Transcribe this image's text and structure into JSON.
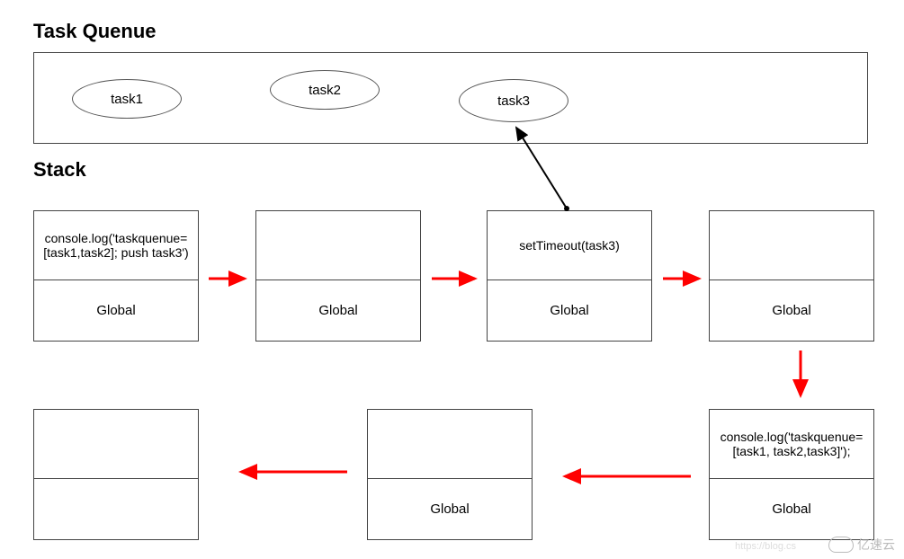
{
  "headings": {
    "queue": "Task Quenue",
    "stack": "Stack"
  },
  "queue": {
    "tasks": [
      "task1",
      "task2",
      "task3"
    ]
  },
  "stacks_row1": [
    {
      "top": "console.log('taskquenue=[task1,task2]; push task3')",
      "bottom": "Global"
    },
    {
      "top": "",
      "bottom": "Global"
    },
    {
      "top": "setTimeout(task3)",
      "bottom": "Global"
    },
    {
      "top": "",
      "bottom": "Global"
    }
  ],
  "stacks_row2": [
    {
      "top": "",
      "bottom": ""
    },
    {
      "top": "",
      "bottom": "Global"
    },
    {
      "top": "console.log('taskquenue=[task1, task2,task3]');",
      "bottom": "Global"
    }
  ],
  "watermark": {
    "text": "亿速云",
    "url": "https://blog.cs"
  },
  "chart_data": {
    "type": "diagram",
    "description": "JavaScript event loop: task queue and call stack snapshots",
    "task_queue": [
      "task1",
      "task2",
      "task3"
    ],
    "stack_snapshots_sequence": [
      {
        "step": 1,
        "frames": [
          "Global",
          "console.log('taskquenue=[task1,task2]; push task3')"
        ]
      },
      {
        "step": 2,
        "frames": [
          "Global"
        ]
      },
      {
        "step": 3,
        "frames": [
          "Global",
          "setTimeout(task3)"
        ],
        "pushes_to_queue": "task3"
      },
      {
        "step": 4,
        "frames": [
          "Global"
        ]
      },
      {
        "step": 5,
        "frames": [
          "Global",
          "console.log('taskquenue=[task1, task2,task3]');"
        ]
      },
      {
        "step": 6,
        "frames": [
          "Global"
        ]
      },
      {
        "step": 7,
        "frames": []
      }
    ],
    "flow_arrows": [
      {
        "from": 1,
        "to": 2
      },
      {
        "from": 2,
        "to": 3
      },
      {
        "from": 3,
        "to": 4
      },
      {
        "from": 4,
        "to": 5
      },
      {
        "from": 5,
        "to": 6
      },
      {
        "from": 6,
        "to": 7
      }
    ]
  }
}
